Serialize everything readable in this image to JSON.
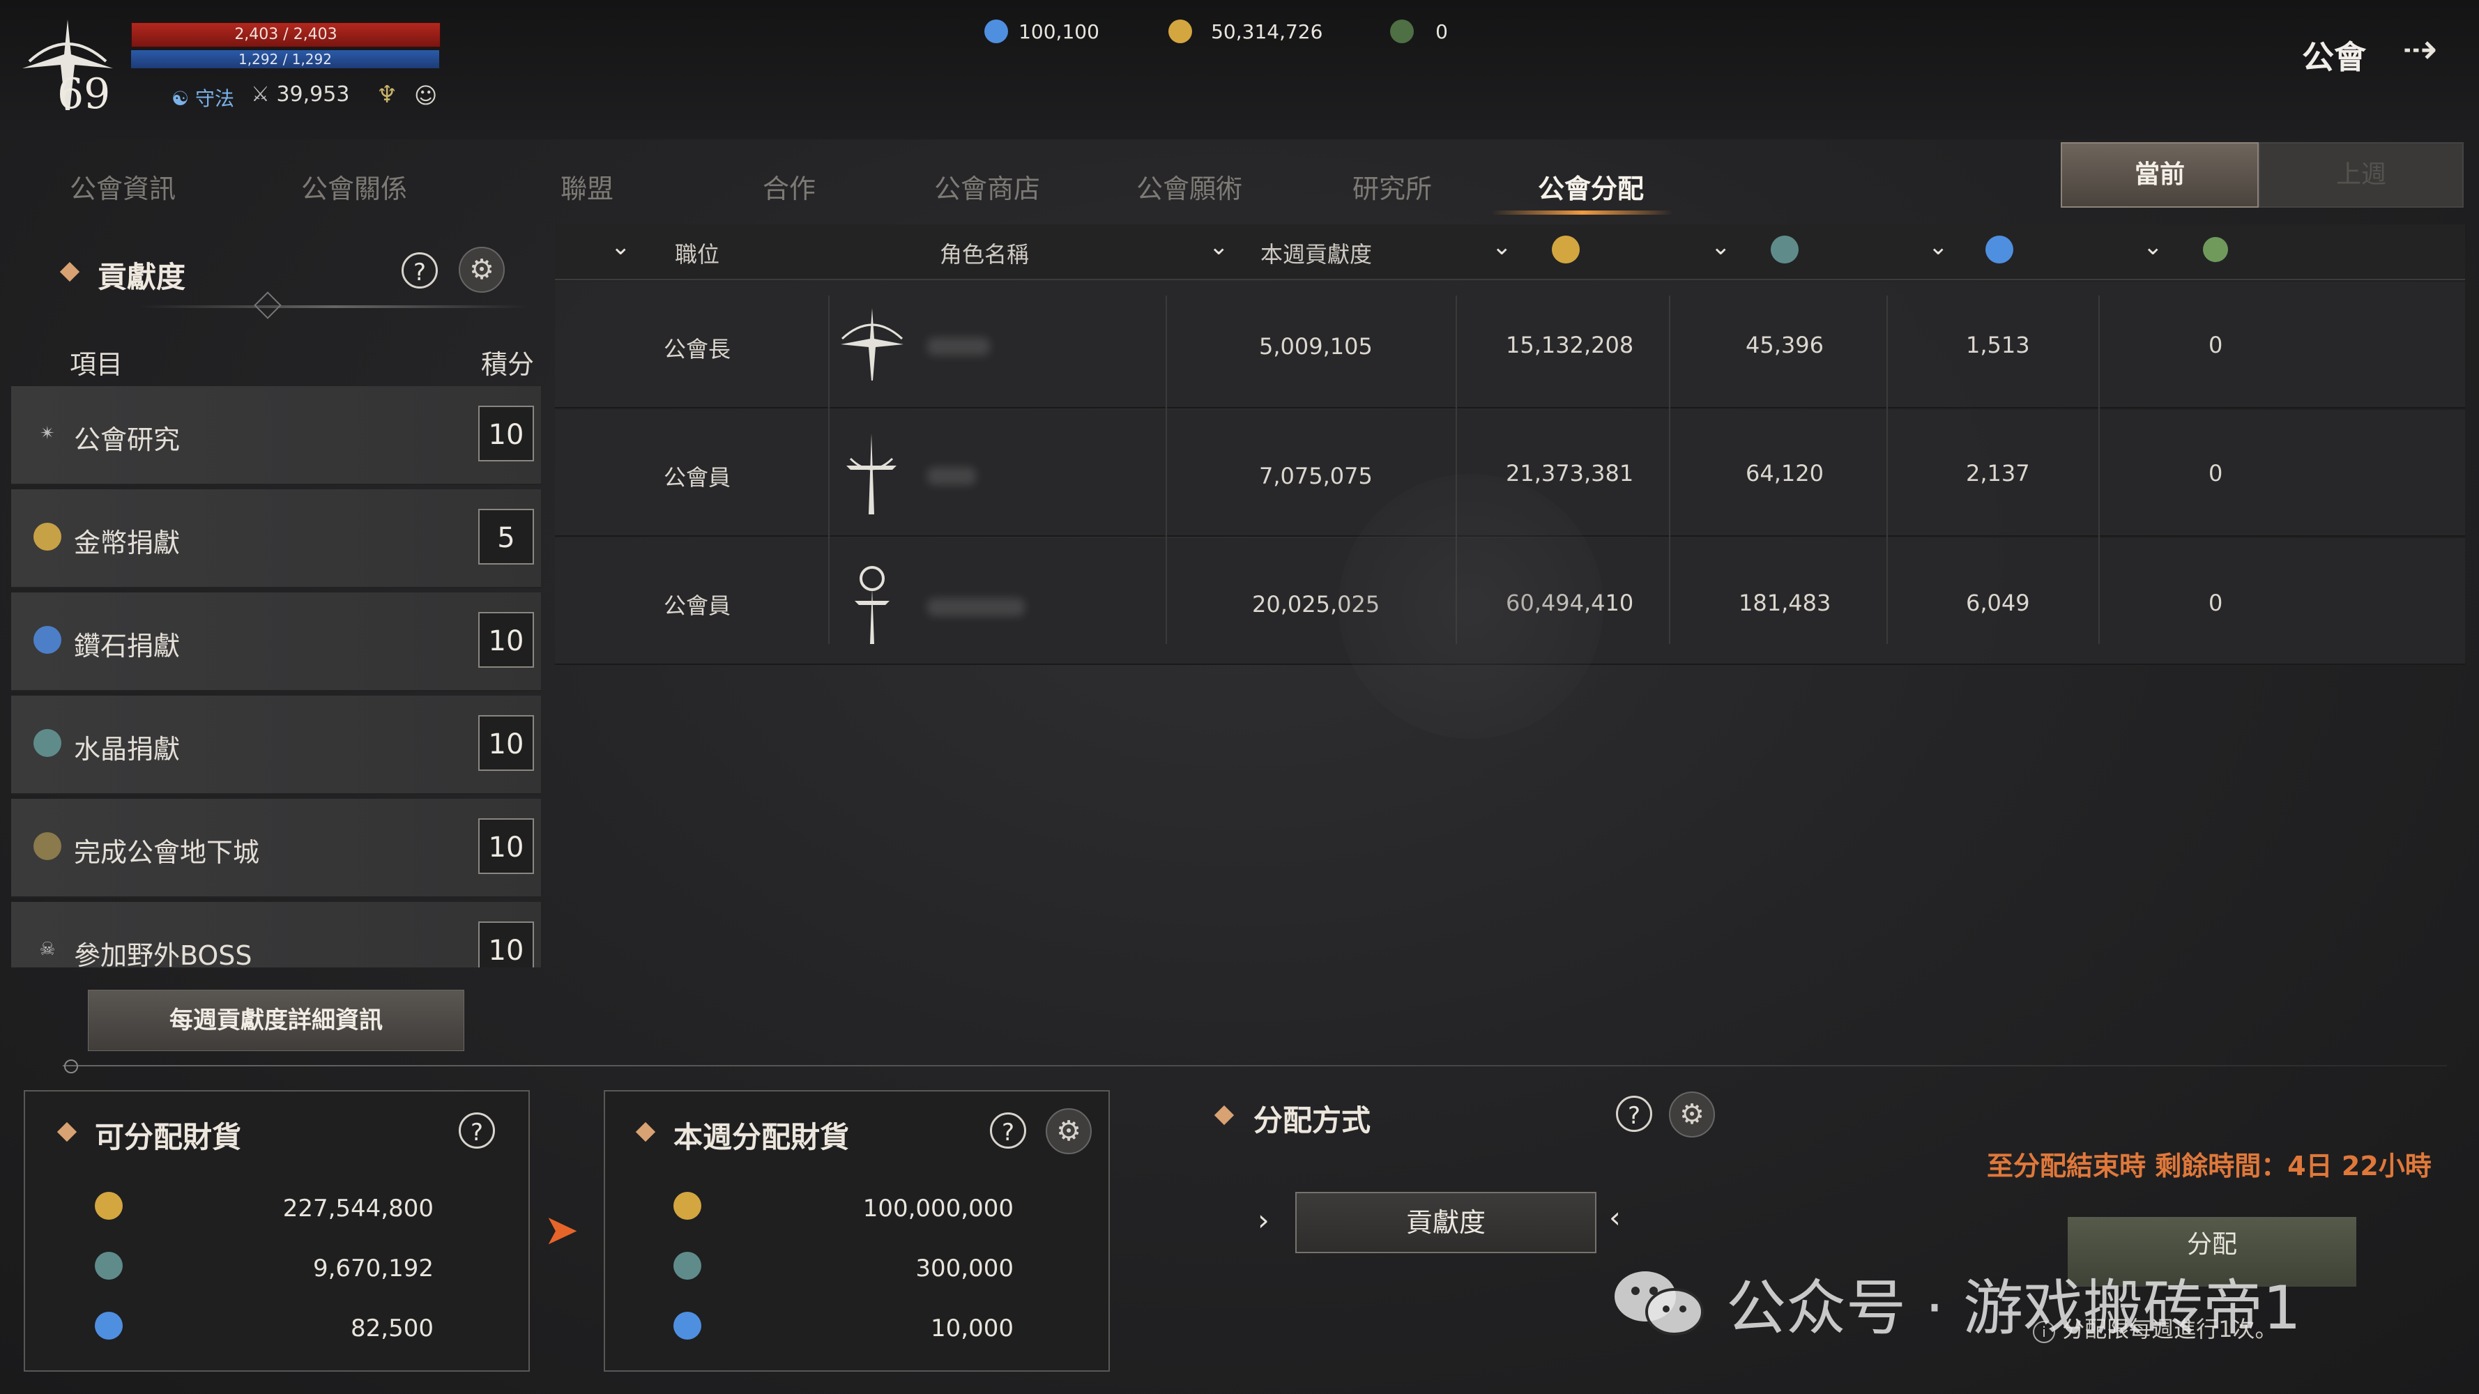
{
  "top_bar": {
    "hp": "2,403 / 2,403",
    "mp": "1,292 / 1,292",
    "level": "69",
    "stance": "守法",
    "combat_power": "39,953",
    "currencies": [
      {
        "icon": "blue-diamond-icon",
        "value": "100,100",
        "color": "#4f8fe0"
      },
      {
        "icon": "gold-coin-icon",
        "value": "50,314,726",
        "color": "#d4a640"
      },
      {
        "icon": "green-gem-icon",
        "value": "0",
        "color": "#6f9a5c"
      }
    ],
    "guild_label": "公會"
  },
  "tabs": [
    "公會資訊",
    "公會關係",
    "聯盟",
    "合作",
    "公會商店",
    "公會願術",
    "研究所",
    "公會分配"
  ],
  "period_buttons": {
    "current": "當前",
    "last": "上週"
  },
  "contribution_panel": {
    "title": "貢獻度",
    "col_item": "項目",
    "col_score": "積分",
    "items": [
      {
        "label": "公會研究",
        "score": "10",
        "icon": "research-icon"
      },
      {
        "label": "金幣捐獻",
        "score": "5",
        "icon": "gold-coin-icon"
      },
      {
        "label": "鑽石捐獻",
        "score": "10",
        "icon": "diamond-icon"
      },
      {
        "label": "水晶捐獻",
        "score": "10",
        "icon": "crystal-icon"
      },
      {
        "label": "完成公會地下城",
        "score": "10",
        "icon": "dungeon-icon"
      },
      {
        "label": "參加野外BOSS",
        "score": "10",
        "icon": "boss-icon"
      }
    ],
    "weekly_detail_button": "每週貢獻度詳細資訊"
  },
  "table": {
    "headers": {
      "rank": "職位",
      "name": "角色名稱",
      "contribution": "本週貢獻度"
    },
    "rows": [
      {
        "rank": "公會長",
        "contribution": "5,009,105",
        "gold": "15,132,208",
        "crystal": "45,396",
        "diamond": "1,513",
        "other": "0"
      },
      {
        "rank": "公會員",
        "contribution": "7,075,075",
        "gold": "21,373,381",
        "crystal": "64,120",
        "diamond": "2,137",
        "other": "0"
      },
      {
        "rank": "公會員",
        "contribution": "20,025,025",
        "gold": "60,494,410",
        "crystal": "181,483",
        "diamond": "6,049",
        "other": "0"
      }
    ]
  },
  "distributable": {
    "title": "可分配財貨",
    "amounts": [
      "227,544,800",
      "9,670,192",
      "82,500"
    ]
  },
  "weekly_distribution": {
    "title": "本週分配財貨",
    "amounts": [
      "100,000,000",
      "300,000",
      "10,000"
    ]
  },
  "method": {
    "title": "分配方式",
    "selected": "貢獻度"
  },
  "remaining_time": "至分配結束時 剩餘時間：4日 22小時",
  "distribute_button": "分配",
  "distribute_note": "分配限每週進行1次。",
  "watermark": "公众号 · 游戏搬砖帝1"
}
